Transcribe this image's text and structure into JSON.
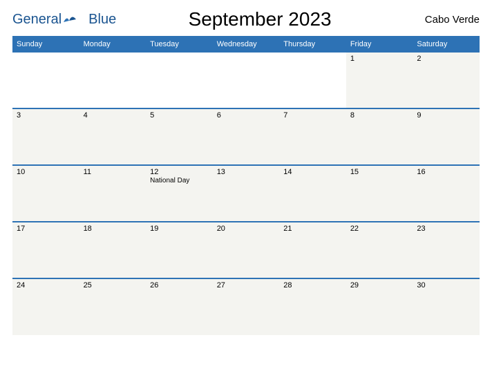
{
  "logo": {
    "general": "General",
    "blue": "Blue"
  },
  "title": "September 2023",
  "region": "Cabo Verde",
  "dayNames": [
    "Sunday",
    "Monday",
    "Tuesday",
    "Wednesday",
    "Thursday",
    "Friday",
    "Saturday"
  ],
  "weeks": [
    [
      {
        "num": "",
        "event": ""
      },
      {
        "num": "",
        "event": ""
      },
      {
        "num": "",
        "event": ""
      },
      {
        "num": "",
        "event": ""
      },
      {
        "num": "",
        "event": ""
      },
      {
        "num": "1",
        "event": ""
      },
      {
        "num": "2",
        "event": ""
      }
    ],
    [
      {
        "num": "3",
        "event": ""
      },
      {
        "num": "4",
        "event": ""
      },
      {
        "num": "5",
        "event": ""
      },
      {
        "num": "6",
        "event": ""
      },
      {
        "num": "7",
        "event": ""
      },
      {
        "num": "8",
        "event": ""
      },
      {
        "num": "9",
        "event": ""
      }
    ],
    [
      {
        "num": "10",
        "event": ""
      },
      {
        "num": "11",
        "event": ""
      },
      {
        "num": "12",
        "event": "National Day"
      },
      {
        "num": "13",
        "event": ""
      },
      {
        "num": "14",
        "event": ""
      },
      {
        "num": "15",
        "event": ""
      },
      {
        "num": "16",
        "event": ""
      }
    ],
    [
      {
        "num": "17",
        "event": ""
      },
      {
        "num": "18",
        "event": ""
      },
      {
        "num": "19",
        "event": ""
      },
      {
        "num": "20",
        "event": ""
      },
      {
        "num": "21",
        "event": ""
      },
      {
        "num": "22",
        "event": ""
      },
      {
        "num": "23",
        "event": ""
      }
    ],
    [
      {
        "num": "24",
        "event": ""
      },
      {
        "num": "25",
        "event": ""
      },
      {
        "num": "26",
        "event": ""
      },
      {
        "num": "27",
        "event": ""
      },
      {
        "num": "28",
        "event": ""
      },
      {
        "num": "29",
        "event": ""
      },
      {
        "num": "30",
        "event": ""
      }
    ]
  ]
}
